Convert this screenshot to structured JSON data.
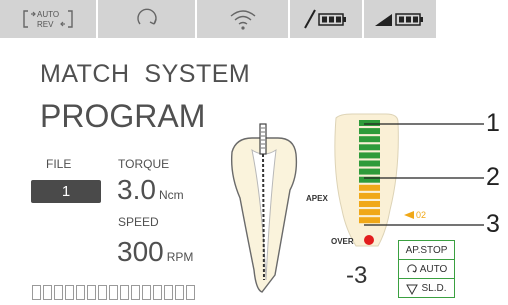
{
  "tabs": {
    "auto_rev": [
      "AUTO",
      "REV"
    ],
    "icons": [
      "auto-reverse-icon",
      "rotation-icon",
      "wireless-icon",
      "file-battery-icon",
      "handpiece-battery-icon"
    ]
  },
  "header": {
    "line1": "MATCH  SYSTEM",
    "line2": "PROGRAM"
  },
  "file": {
    "label": "FILE",
    "value": "1"
  },
  "torque": {
    "label": "TORQUE",
    "value": "3.0",
    "unit": "Ncm"
  },
  "speed": {
    "label": "SPEED",
    "value": "300",
    "unit": "RPM"
  },
  "apex_meter": {
    "apex_label": "APEX",
    "over_label": "OVER",
    "marker_value": "02",
    "reading": "-3",
    "green_bars": 8,
    "yellow_bars": 5,
    "colors": {
      "green": "#2e9b3a",
      "yellow": "#f0a818",
      "red": "#e21d1d"
    }
  },
  "modes": [
    "AP.STOP",
    "AUTO",
    "SL.D."
  ],
  "callouts": [
    "1",
    "2",
    "3"
  ],
  "segments": 15
}
